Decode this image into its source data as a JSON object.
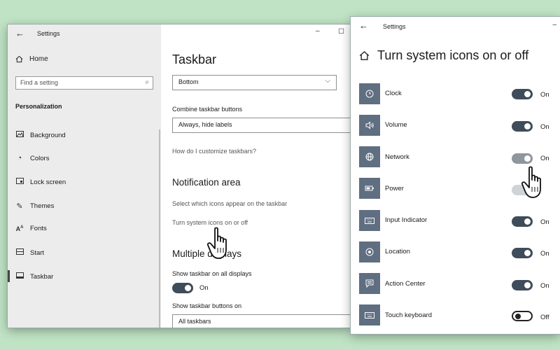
{
  "window_left": {
    "title": "Settings",
    "sidebar": {
      "home_label": "Home",
      "search_placeholder": "Find a setting",
      "section_label": "Personalization",
      "items": [
        {
          "label": "Background",
          "icon": "image-icon"
        },
        {
          "label": "Colors",
          "icon": "palette-icon"
        },
        {
          "label": "Lock screen",
          "icon": "lock-screen-icon"
        },
        {
          "label": "Themes",
          "icon": "brush-icon"
        },
        {
          "label": "Fonts",
          "icon": "font-icon"
        },
        {
          "label": "Start",
          "icon": "start-icon"
        },
        {
          "label": "Taskbar",
          "icon": "taskbar-icon",
          "active": true
        }
      ]
    },
    "main": {
      "heading": "Taskbar",
      "position_value": "Bottom",
      "combine_label": "Combine taskbar buttons",
      "combine_value": "Always, hide labels",
      "customize_link": "How do I customize taskbars?",
      "notification_heading": "Notification area",
      "select_icons_link": "Select which icons appear on the taskbar",
      "system_icons_link": "Turn system icons on or off",
      "multiple_heading": "Multiple displays",
      "show_all_label": "Show taskbar on all displays",
      "show_all_state": "On",
      "show_buttons_label": "Show taskbar buttons on",
      "show_buttons_value": "All taskbars"
    }
  },
  "window_right": {
    "title": "Settings",
    "heading": "Turn system icons on or off",
    "rows": [
      {
        "label": "Clock",
        "state": "On",
        "icon": "clock-icon"
      },
      {
        "label": "Volume",
        "state": "On",
        "icon": "volume-icon"
      },
      {
        "label": "Network",
        "state": "On",
        "icon": "network-icon"
      },
      {
        "label": "Power",
        "state": "",
        "icon": "power-icon"
      },
      {
        "label": "Input Indicator",
        "state": "On",
        "icon": "keyboard-icon"
      },
      {
        "label": "Location",
        "state": "On",
        "icon": "location-icon"
      },
      {
        "label": "Action Center",
        "state": "On",
        "icon": "action-center-icon"
      },
      {
        "label": "Touch keyboard",
        "state": "Off",
        "icon": "touch-keyboard-icon"
      }
    ]
  },
  "colors": {
    "background": "#bfe3c4",
    "toggle_on": "#3f4c5a",
    "icon_tile": "#5f6e80"
  }
}
